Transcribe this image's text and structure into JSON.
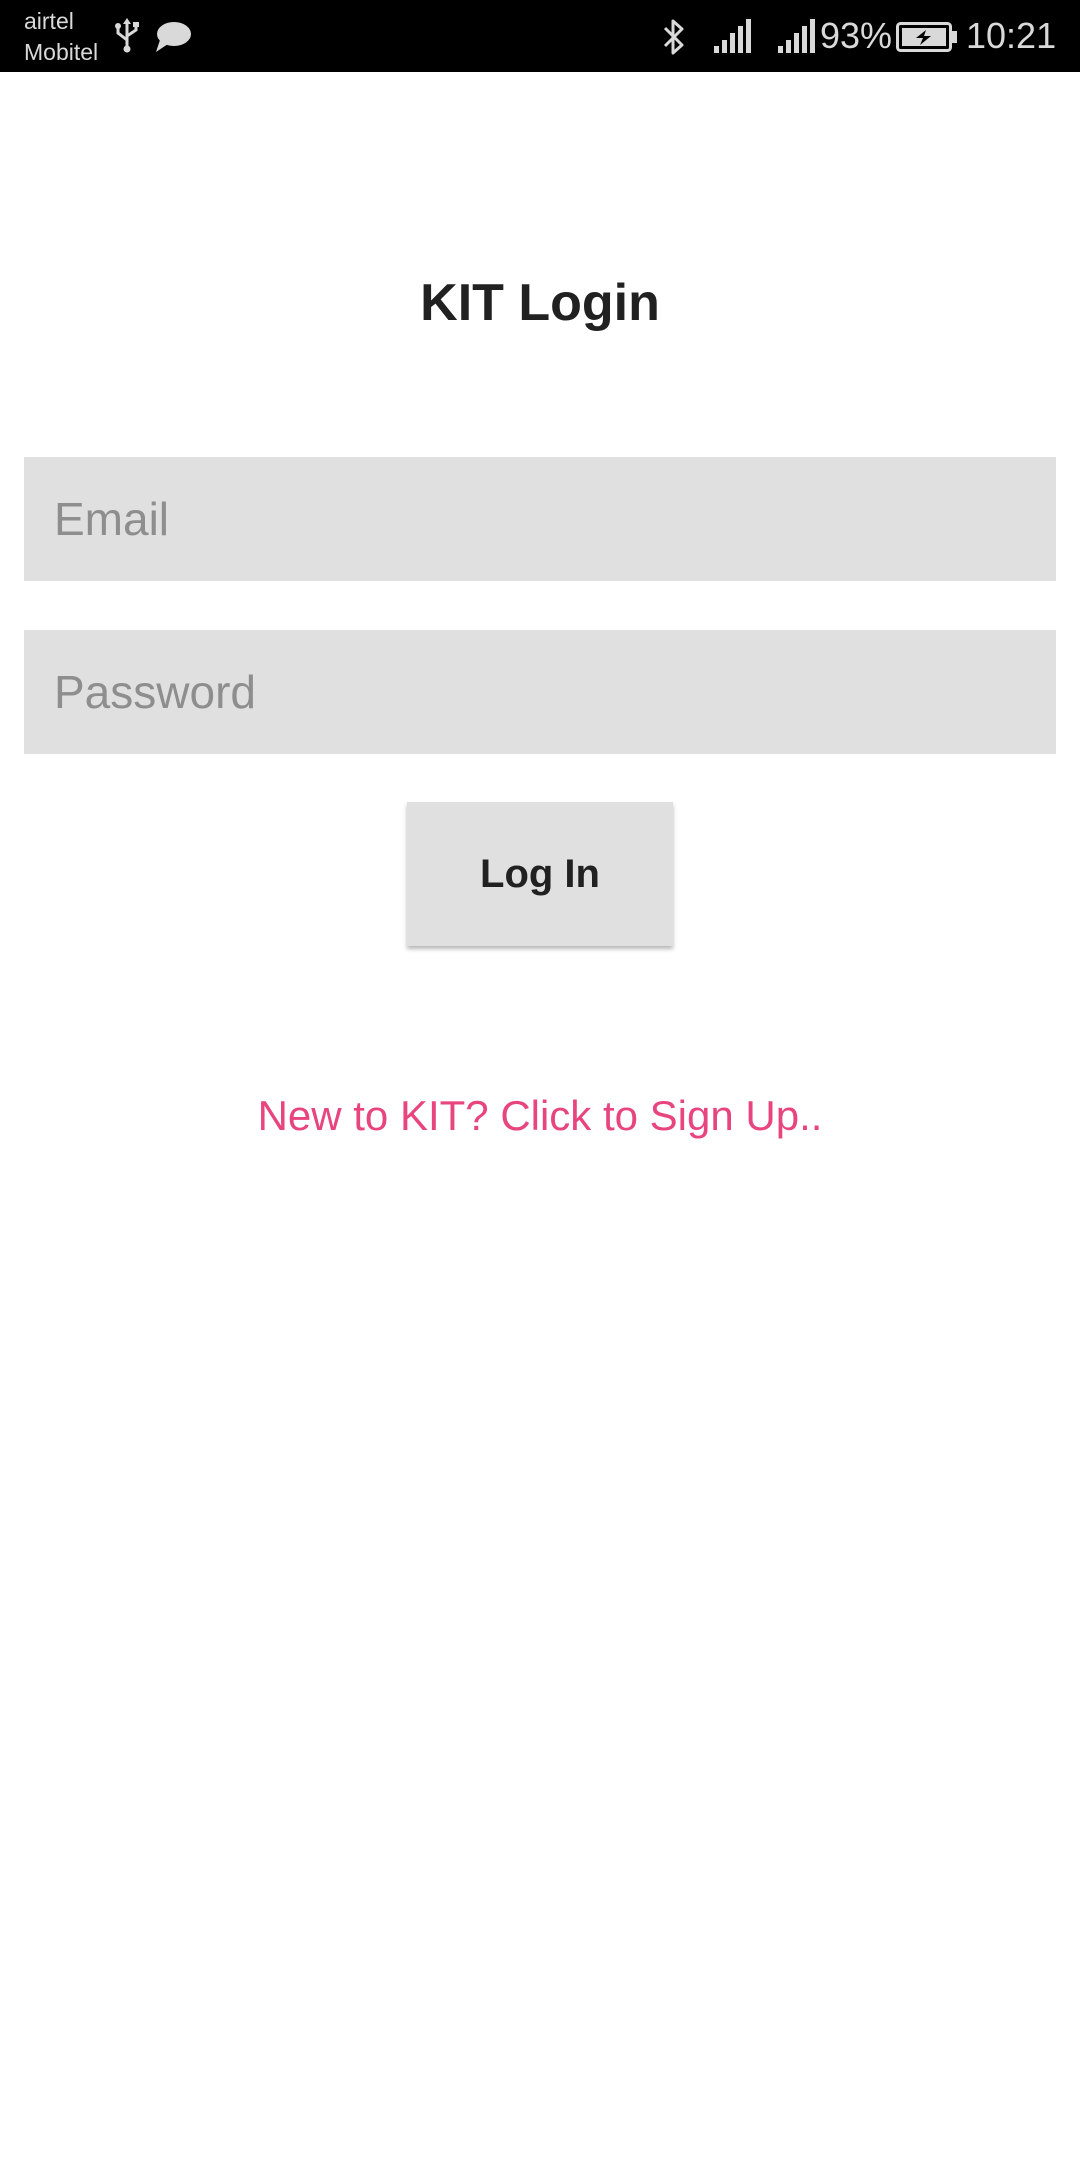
{
  "status_bar": {
    "carrier_1": "airtel",
    "carrier_2": "Mobitel",
    "battery_percent": "93%",
    "time": "10:21",
    "icons": [
      "usb-icon",
      "chat-icon",
      "bluetooth-icon",
      "signal-icon",
      "signal-icon",
      "battery-charging-icon"
    ]
  },
  "login": {
    "title": "KIT Login",
    "email_placeholder": "Email",
    "email_value": "",
    "password_placeholder": "Password",
    "password_value": "",
    "login_label": "Log In",
    "signup_text": "New to KIT? Click to Sign Up.."
  },
  "colors": {
    "accent": "#e8457f",
    "field_bg": "#e0e0e0",
    "status_bar_bg": "#000000",
    "text": "#212121",
    "placeholder": "#8e8e8e"
  }
}
